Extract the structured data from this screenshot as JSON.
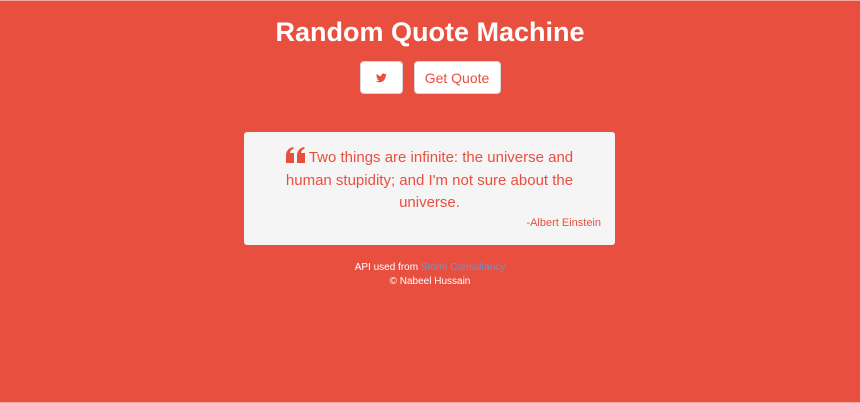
{
  "header": {
    "title": "Random Quote Machine"
  },
  "buttons": {
    "tweet_icon": "twitter-icon",
    "get_quote_label": "Get Quote"
  },
  "quote": {
    "text": "Two things are infinite: the universe and human stupidity; and I'm not sure about the universe.",
    "author": "-Albert Einstein",
    "quote_icon": "quote-left-icon"
  },
  "footer": {
    "api_prefix": "API used from ",
    "api_link_text": "Storm Consultancy",
    "credit": "© Nabeel Hussain"
  },
  "colors": {
    "background": "#e94f3f",
    "card": "#f5f5f5",
    "link": "#7a8fc2",
    "text_on_bg": "#ffffff"
  }
}
